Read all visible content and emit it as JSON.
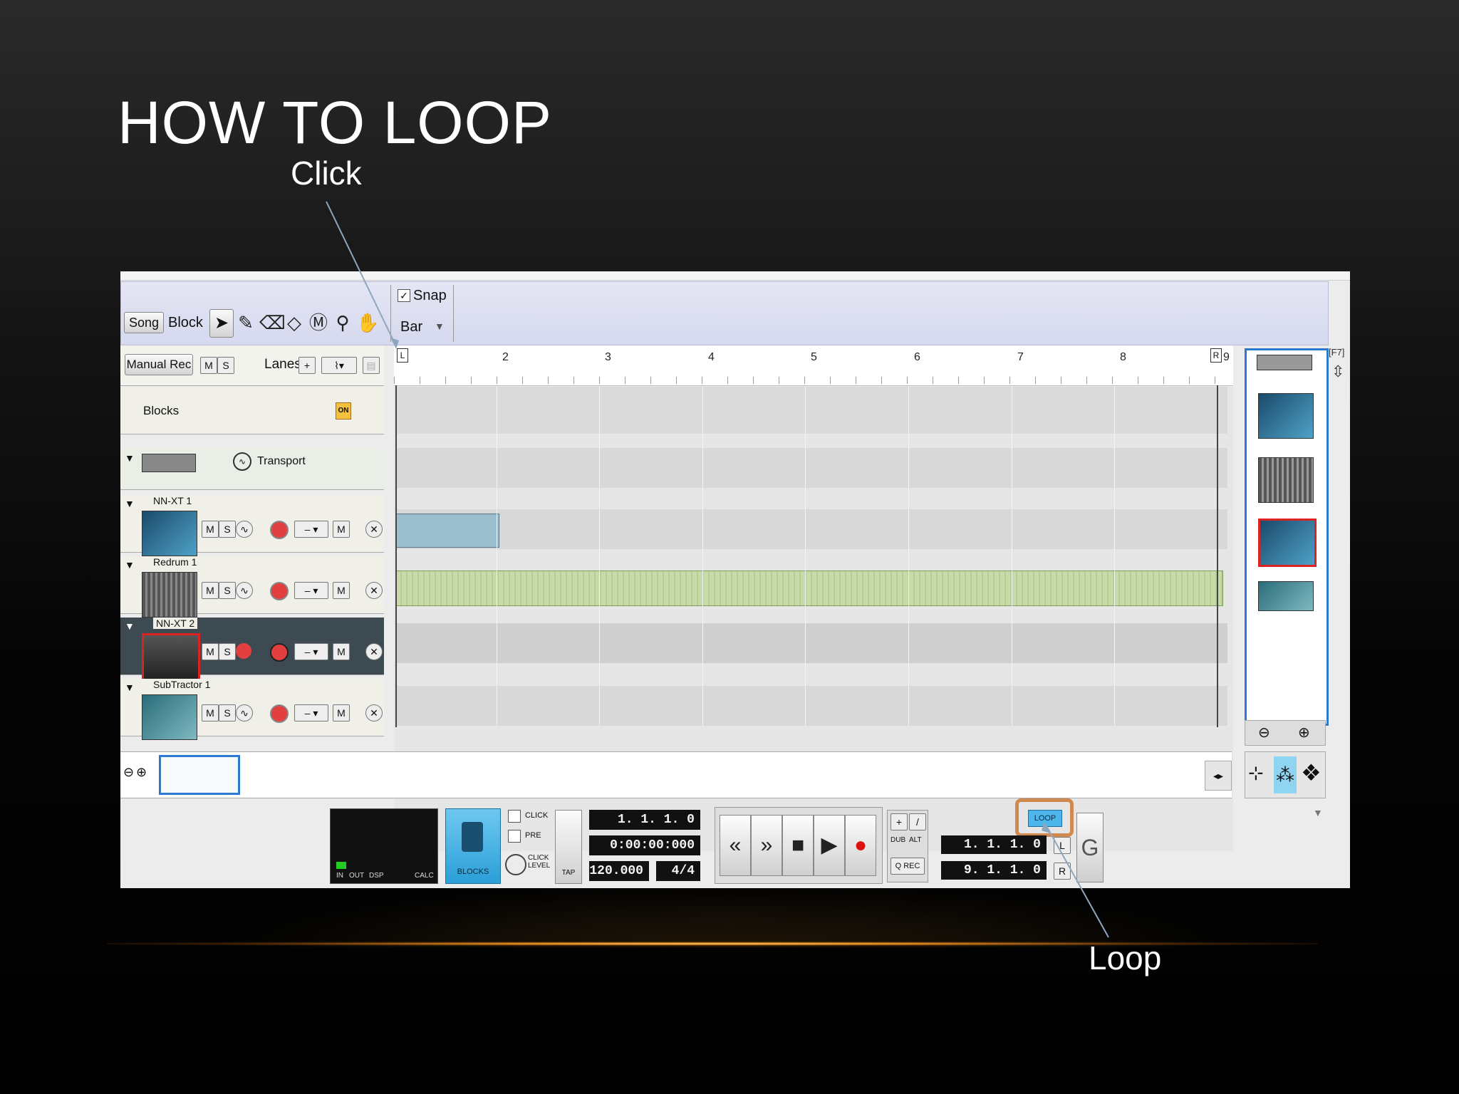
{
  "slide": {
    "title": "HOW TO LOOP",
    "click_label": "Click",
    "loop_label": "Loop"
  },
  "toolbar": {
    "song_label": "Song",
    "block_label": "Block",
    "snap_label": "Snap",
    "snap_checked": "✓",
    "bar_label": "Bar",
    "tools": [
      "arrow-tool-icon",
      "pencil-tool-icon",
      "eraser-tool-icon",
      "razor-tool-icon",
      "mute-tool-icon",
      "magnify-tool-icon",
      "hand-tool-icon"
    ]
  },
  "sequencer": {
    "manual_rec_label": "Manual Rec",
    "m_label": "M",
    "s_label": "S",
    "lanes_label": "Lanes",
    "lanes_add": "+",
    "blocks_label": "Blocks",
    "on_label": "ON",
    "loop_left_marker": "L",
    "loop_right_marker": "R",
    "bar_numbers": [
      "2",
      "3",
      "4",
      "5",
      "6",
      "7",
      "8",
      "9"
    ],
    "f7_label": "[F7]"
  },
  "tracks": [
    {
      "name": "Transport"
    },
    {
      "name": "NN-XT 1"
    },
    {
      "name": "Redrum 1"
    },
    {
      "name": "NN-XT 2"
    },
    {
      "name": "SubTractor 1"
    }
  ],
  "transport": {
    "in_label": "IN",
    "out_label": "OUT",
    "dsp_label": "DSP",
    "calc_label": "CALC",
    "blocks_button": "BLOCKS",
    "click_label": "CLICK",
    "pre_label": "PRE",
    "click_level_label": "CLICK LEVEL",
    "tap_label": "TAP",
    "position": "1. 1. 1.   0",
    "time": "0:00:00:000",
    "tempo": "120.000",
    "signature": "4/4",
    "dub_label": "DUB",
    "alt_label": "ALT",
    "q_rec_label": "Q REC",
    "loop_button": "LOOP",
    "loop_left": "1. 1. 1.   0",
    "loop_right": "9. 1. 1.   0",
    "l_label": "L",
    "r_label": "R"
  }
}
